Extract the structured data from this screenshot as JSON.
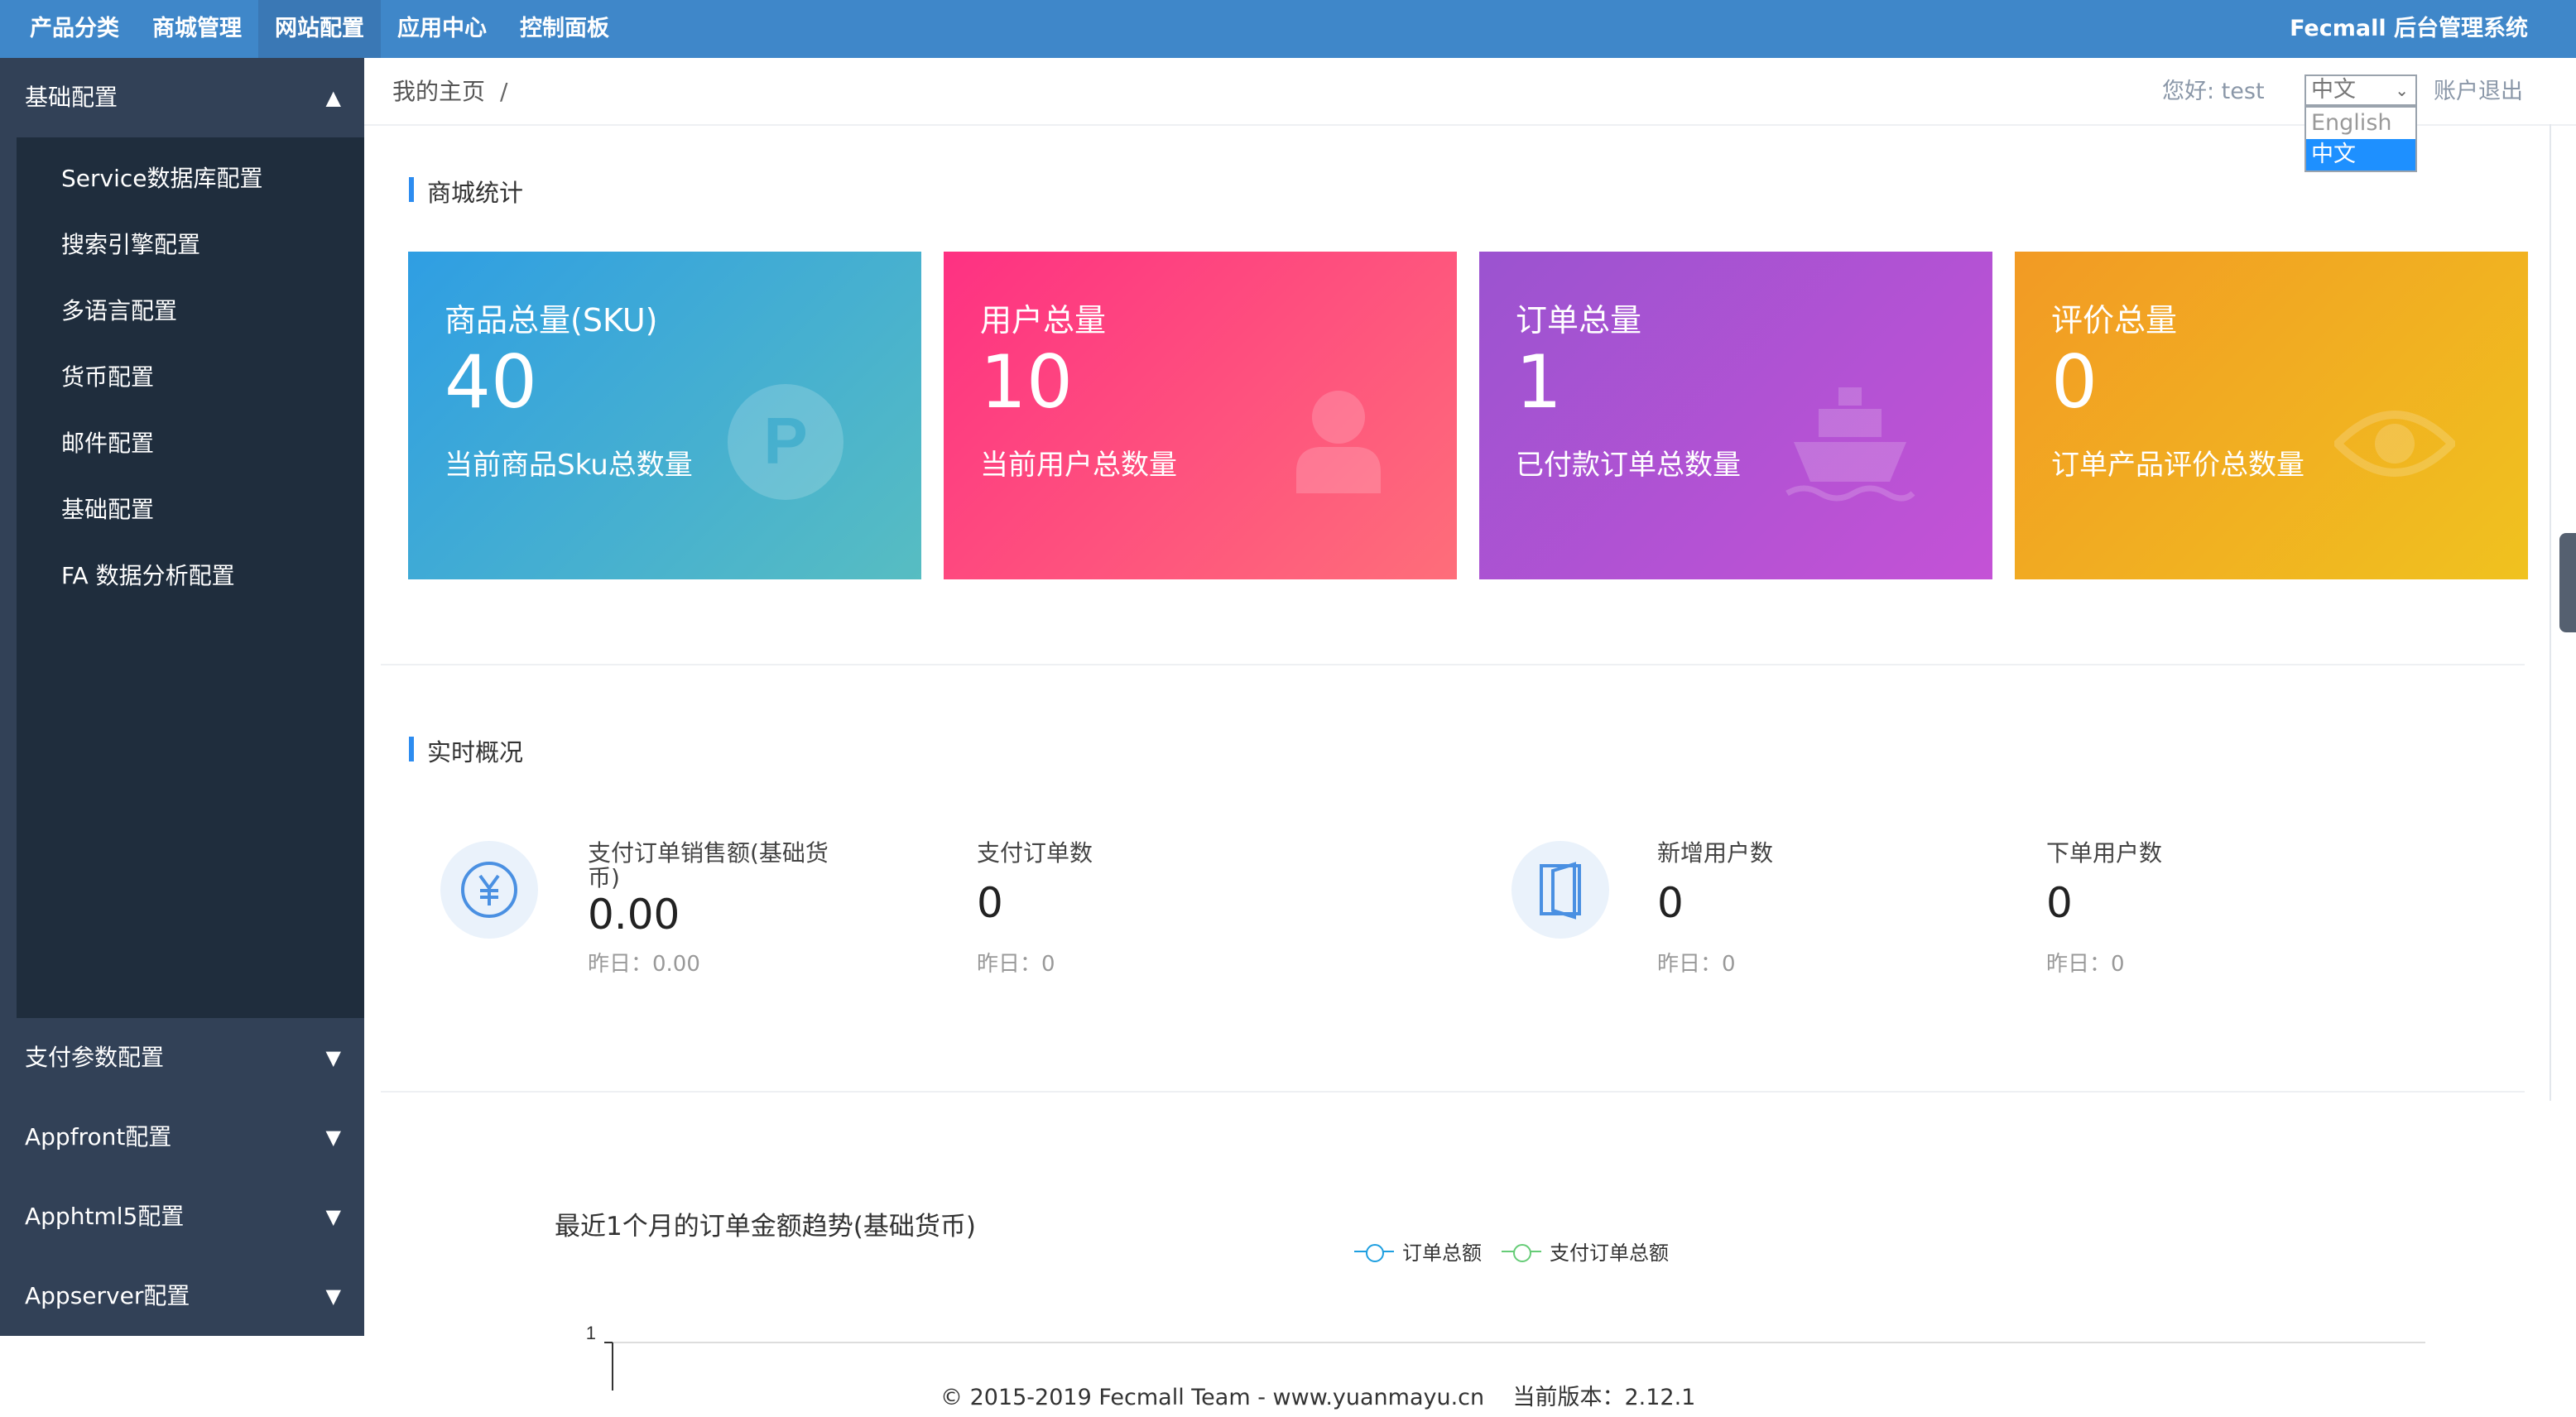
{
  "topnav": {
    "items": [
      {
        "label": "产品分类"
      },
      {
        "label": "商城管理"
      },
      {
        "label": "网站配置"
      },
      {
        "label": "应用中心"
      },
      {
        "label": "控制面板"
      }
    ],
    "active_index": 2,
    "brand": "Fecmall 后台管理系统"
  },
  "sidebar": {
    "expanded": {
      "label": "基础配置",
      "caret": "caret-up-icon"
    },
    "sub_items": [
      {
        "label": "Service数据库配置"
      },
      {
        "label": "搜索引擎配置"
      },
      {
        "label": "多语言配置"
      },
      {
        "label": "货币配置"
      },
      {
        "label": "邮件配置"
      },
      {
        "label": "基础配置"
      },
      {
        "label": "FA 数据分析配置"
      }
    ],
    "groups": [
      {
        "label": "支付参数配置"
      },
      {
        "label": "Appfront配置"
      },
      {
        "label": "Apphtml5配置"
      },
      {
        "label": "Appserver配置"
      }
    ]
  },
  "header": {
    "breadcrumb": "我的主页",
    "separator": "/",
    "greeting": "您好: test",
    "language": {
      "selected": "中文",
      "options": [
        "English",
        "中文"
      ],
      "highlighted": "中文"
    },
    "logout": "账户退出"
  },
  "stats": {
    "section_title": "商城统计",
    "cards": [
      {
        "title": "商品总量(SKU)",
        "value": "40",
        "desc": "当前商品Sku总数量",
        "icon": "parking-icon"
      },
      {
        "title": "用户总量",
        "value": "10",
        "desc": "当前用户总数量",
        "icon": "user-icon"
      },
      {
        "title": "订单总量",
        "value": "1",
        "desc": "已付款订单总数量",
        "icon": "ship-icon"
      },
      {
        "title": "评价总量",
        "value": "0",
        "desc": "订单产品评价总数量",
        "icon": "eye-icon"
      }
    ]
  },
  "realtime": {
    "section_title": "实时概况",
    "metrics": [
      {
        "label": "支付订单销售额(基础货币)",
        "value": "0.00",
        "yesterday": "昨日：0.00",
        "icon": "yen-icon"
      },
      {
        "label": "支付订单数",
        "value": "0",
        "yesterday": "昨日：0"
      },
      {
        "label": "新增用户数",
        "value": "0",
        "yesterday": "昨日：0",
        "icon": "door-icon"
      },
      {
        "label": "下单用户数",
        "value": "0",
        "yesterday": "昨日：0"
      }
    ]
  },
  "chart_data": {
    "type": "line",
    "title": "最近1个月的订单金额趋势(基础货币)",
    "series": [
      {
        "name": "订单总额",
        "values": []
      },
      {
        "name": "支付订单总额",
        "values": []
      }
    ],
    "y_ticks": [
      "1"
    ],
    "colors": [
      "#1e9fe0",
      "#66cc77"
    ]
  },
  "footer": {
    "copyright": "© 2015-2019 Fecmall Team - www.yuanmayu.cn",
    "version": "当前版本：2.12.1"
  }
}
